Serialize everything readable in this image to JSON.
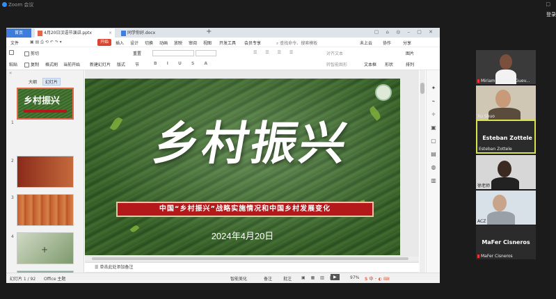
{
  "zoom": {
    "title": "Zoom 会议",
    "login": "登录",
    "window_controls": "□"
  },
  "wps": {
    "tabs": {
      "home": "首页",
      "active": "4月20日汉语节演讲.pptx",
      "second": "同学你好.docx",
      "new_tab": "+"
    },
    "menu": [
      "文件",
      "开始",
      "插入",
      "设计",
      "切换",
      "动画",
      "放映",
      "审阅",
      "视图",
      "开发工具",
      "会员专享"
    ],
    "menu_start": "开始",
    "search": "查找命令、搜索模板",
    "cloud": [
      "未上云",
      "协作",
      "分享"
    ],
    "ribbon": {
      "paste": "粘贴",
      "cut": "剪切",
      "copy": "复制",
      "format_painter": "格式刷",
      "play": "当前开始",
      "new_slide": "新建幻灯片",
      "layout": "版式",
      "section": "节",
      "reset": "重置",
      "text_box": "文本框",
      "shape": "形状",
      "arrange": "排列",
      "picture": "图片",
      "align_text": "对齐文本",
      "convert_smartart": "转智能图形"
    },
    "left_tabs": {
      "outline": "大纲",
      "slides": "幻灯片"
    },
    "thumbs": [
      "1",
      "2",
      "3",
      "4",
      "5"
    ],
    "slide": {
      "title": "乡村振兴",
      "banner": "中国“乡村振兴”战略实施情况和中国乡村发展变化",
      "date": "2024年4月20日"
    },
    "notes": "单击此处添加备注",
    "status": {
      "slide_count": "幻灯片 1 / 92",
      "theme": "Office 主题",
      "beautify": "智能美化",
      "notes_btn": "备注",
      "comment_btn": "批注",
      "zoom": "97%"
    }
  },
  "participants": [
    {
      "name": "Miriam Sanchez  Guev...",
      "muted": true
    },
    {
      "name": "Xu Shuo",
      "muted": false
    },
    {
      "name": "Esteban Zottele",
      "label": "Esteban Zottele",
      "active_speaker": true
    },
    {
      "name": "徐老师",
      "muted": false
    },
    {
      "name": "ACZ",
      "muted": false
    },
    {
      "name": "MaFer Cisneros",
      "label": "MaFer Cisneros",
      "muted": true
    }
  ],
  "colors": {
    "accent": "#3f7ddc",
    "start_tab": "#d8442f",
    "banner": "#b3181b",
    "speaker_border": "#d8e34d"
  }
}
